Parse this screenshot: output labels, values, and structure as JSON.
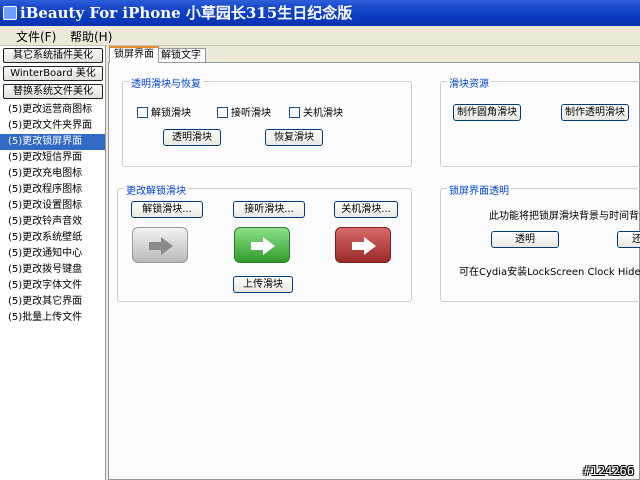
{
  "window": {
    "title": "iBeauty For iPhone 小草园长315生日纪念版"
  },
  "menu": {
    "items": [
      "文件(F)",
      "帮助(H)"
    ]
  },
  "sidebar": {
    "buttons": [
      "其它系统插件美化",
      "WinterBoard 美化",
      "替换系统文件美化"
    ],
    "items": [
      "(5)更改运营商图标",
      "(5)更改文件夹界面",
      "(5)更改锁屏界面",
      "(5)更改短信界面",
      "(5)更改充电图标",
      "(5)更改程序图标",
      "(5)更改设置图标",
      "(5)更改铃声音效",
      "(5)更改系统壁纸",
      "(5)更改通知中心",
      "(5)更改拨号键盘",
      "(5)更改字体文件",
      "(5)更改其它界面",
      "(5)批量上传文件"
    ],
    "selected_index": 2
  },
  "tabs": [
    "锁屏界面",
    "解锁文字"
  ],
  "groups": {
    "transparent": {
      "title": "透明滑块与恢复",
      "checkboxes": [
        "解锁滑块",
        "接听滑块",
        "关机滑块"
      ],
      "buttons": {
        "transparent": "透明滑块",
        "restore": "恢复滑块"
      }
    },
    "resources": {
      "title": "滑块资源",
      "buttons": {
        "rounded": "制作圆角滑块",
        "transparent": "制作透明滑块"
      }
    },
    "change": {
      "title": "更改解锁滑块",
      "buttons": {
        "unlock": "解锁滑块...",
        "answer": "接听滑块...",
        "shutdown": "关机滑块...",
        "upload": "上传滑块"
      }
    },
    "lockscreen": {
      "title": "锁屏界面透明",
      "description": "此功能将把锁屏滑块背景与时间背景",
      "buttons": {
        "transparent": "透明",
        "restore": "还"
      },
      "note": "可在Cydia安装LockScreen Clock Hide，隐藏"
    }
  },
  "watermark": "#124266",
  "colors": {
    "title_bar": "#0a3bc2",
    "selected": "#316ac5",
    "group_title": "#0046d5"
  }
}
